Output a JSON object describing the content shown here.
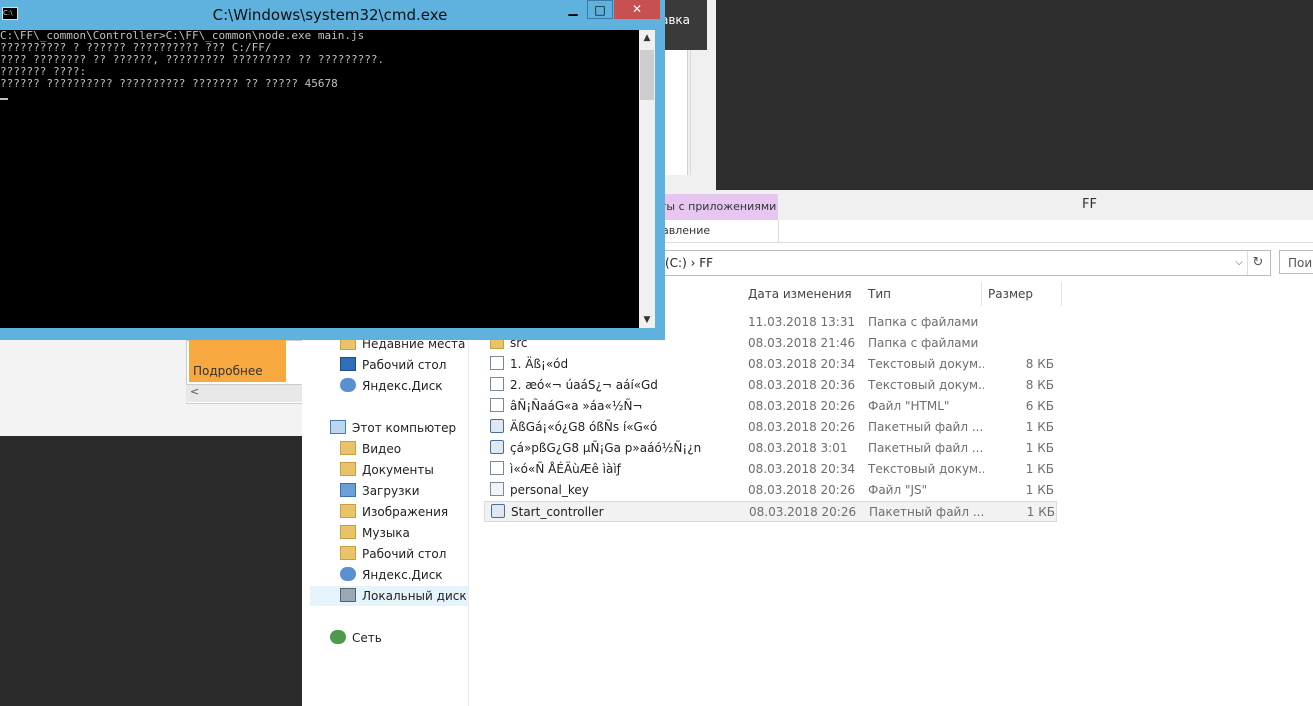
{
  "cmd": {
    "title": "C:\\Windows\\system32\\cmd.exe",
    "lines": [
      "C:\\FF\\_common\\Controller>C:\\FF\\_common\\node.exe main.js",
      "?????????? ? ?????? ?????????? ??? C:/FF/",
      "???? ???????? ?? ??????, ????????? ????????? ?? ?????????.",
      "??????? ????:",
      "?????? ?????????? ?????????? ??????? ?? ????? 45678"
    ],
    "min_glyph": "▁",
    "max_glyph": "□",
    "close_glyph": "✕"
  },
  "background": {
    "strip_tab_label": "авка",
    "tile_label": "Подробнее",
    "scroll_left_glyph": "<"
  },
  "explorer": {
    "title": "FF",
    "context_tab": "ты с приложениями",
    "ribbon_label": "авление",
    "address": {
      "path": "(C:)  ›  FF",
      "dropdown_glyph": "⌵",
      "refresh_glyph": "↻"
    },
    "search_placeholder": "Пои",
    "columns": {
      "date": "Дата изменения",
      "type": "Тип",
      "size": "Размер"
    },
    "nav": {
      "recent": "Недавние места",
      "desktop": "Рабочий стол",
      "yadisk": "Яндекс.Диск",
      "this_pc": "Этот компьютер",
      "video": "Видео",
      "documents": "Документы",
      "downloads": "Загрузки",
      "pictures": "Изображения",
      "music": "Музыка",
      "desktop2": "Рабочий стол",
      "yadisk2": "Яндекс.Диск",
      "local_disk": "Локальный диск (C",
      "network": "Сеть"
    },
    "files": [
      {
        "name": "",
        "date": "11.03.2018 13:31",
        "type": "Папка с файлами",
        "size": "",
        "icon": "folder-icon"
      },
      {
        "name": "src",
        "date": "08.03.2018 21:46",
        "type": "Папка с файлами",
        "size": "",
        "icon": "folder-icon"
      },
      {
        "name": "1. Äß¡«ód",
        "date": "08.03.2018 20:34",
        "type": "Текстовый докум...",
        "size": "8 КБ",
        "icon": "text-file-icon"
      },
      {
        "name": "2. æó«¬ úaáS¿¬ aáí«Gd",
        "date": "08.03.2018 20:36",
        "type": "Текстовый докум...",
        "size": "8 КБ",
        "icon": "text-file-icon"
      },
      {
        "name": "âÑ¡ÑaáG«a »áa«½Ñ¬",
        "date": "08.03.2018 20:26",
        "type": "Файл \"HTML\"",
        "size": "6 КБ",
        "icon": "html-file-icon"
      },
      {
        "name": "ÄßGá¡«ó¿G8 óßÑs í«G«ó",
        "date": "08.03.2018 20:26",
        "type": "Пакетный файл ...",
        "size": "1 КБ",
        "icon": "batch-file-icon"
      },
      {
        "name": "çá»pßG¿G8 µÑ¡Ga p»aáó½Ñ¡¿n",
        "date": "08.03.2018 3:01",
        "type": "Пакетный файл ...",
        "size": "1 КБ",
        "icon": "batch-file-icon"
      },
      {
        "name": "ì«ó«Ñ ÅÉÄùÆê ìàìƒ",
        "date": "08.03.2018 20:34",
        "type": "Текстовый докум...",
        "size": "1 КБ",
        "icon": "text-file-icon"
      },
      {
        "name": "personal_key",
        "date": "08.03.2018 20:26",
        "type": "Файл \"JS\"",
        "size": "1 КБ",
        "icon": "js-file-icon"
      },
      {
        "name": "Start_controller",
        "date": "08.03.2018 20:26",
        "type": "Пакетный файл ...",
        "size": "1 КБ",
        "icon": "batch-file-icon"
      }
    ]
  }
}
